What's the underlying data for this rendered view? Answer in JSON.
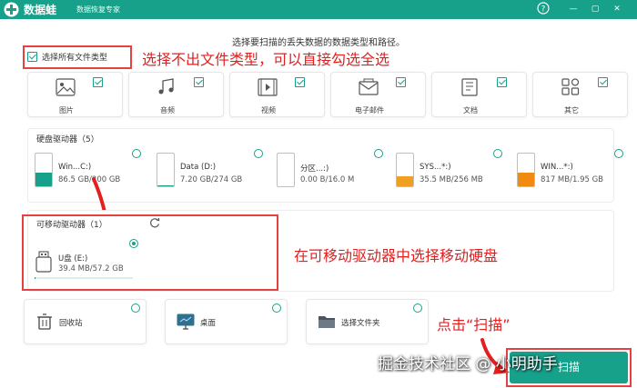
{
  "app": {
    "name": "数据蛙",
    "subtitle": "数据恢复专家"
  },
  "window_controls": {
    "help": "?",
    "minimize": "—",
    "maximize": "▢",
    "close": "✕"
  },
  "instruction": "选择要扫描的丢失数据的数据类型和路径。",
  "select_all": {
    "label": "选择所有文件类型",
    "checked": true
  },
  "file_types": [
    {
      "label": "图片",
      "icon": "image-icon",
      "checked": true
    },
    {
      "label": "音频",
      "icon": "music-icon",
      "checked": true
    },
    {
      "label": "视频",
      "icon": "video-icon",
      "checked": true
    },
    {
      "label": "电子邮件",
      "icon": "email-icon",
      "checked": true
    },
    {
      "label": "文档",
      "icon": "document-icon",
      "checked": true
    },
    {
      "label": "其它",
      "icon": "other-icon",
      "checked": true
    }
  ],
  "hard_drives": {
    "title": "硬盘驱动器（5）",
    "items": [
      {
        "name": "Win...C:)",
        "size": "86.5 GB/200 GB",
        "used_fraction": 0.43,
        "fill_color": "#17a08a",
        "selected": false
      },
      {
        "name": "Data (D:)",
        "size": "7.20 GB/274 GB",
        "used_fraction": 0.03,
        "fill_color": "#17a08a",
        "selected": false
      },
      {
        "name": "分区...:)",
        "size": "0.00  B/16.0 M",
        "used_fraction": 0.0,
        "fill_color": "#17a08a",
        "selected": false
      },
      {
        "name": "SYS...*:)",
        "size": "35.5 MB/256 MB",
        "used_fraction": 0.14,
        "fill_color": "#f0a020",
        "selected": false
      },
      {
        "name": "WIN...*:)",
        "size": "817 MB/1.95 GB",
        "used_fraction": 0.42,
        "fill_color": "#f08a10",
        "selected": false
      }
    ]
  },
  "removable_drives": {
    "title": "可移动驱动器（1）",
    "items": [
      {
        "name": "U盘 (E:)",
        "size": "39.4 MB/57.2 GB",
        "used_fraction": 0.01,
        "selected": true
      }
    ]
  },
  "locations": [
    {
      "label": "回收站",
      "icon": "recycle-bin-icon",
      "selected": false
    },
    {
      "label": "桌面",
      "icon": "desktop-icon",
      "selected": false
    },
    {
      "label": "选择文件夹",
      "icon": "folder-icon",
      "selected": false
    }
  ],
  "annotations": {
    "note1": "选择不出文件类型，可以直接勾选全选",
    "note2": "在可移动驱动器中选择移动硬盘",
    "note3": "点击“扫描”"
  },
  "scan_button": "扫描",
  "watermark": "掘金技术社区 @ 小明助手",
  "colors": {
    "brand": "#17a08a",
    "annotation_red": "#e32020"
  }
}
